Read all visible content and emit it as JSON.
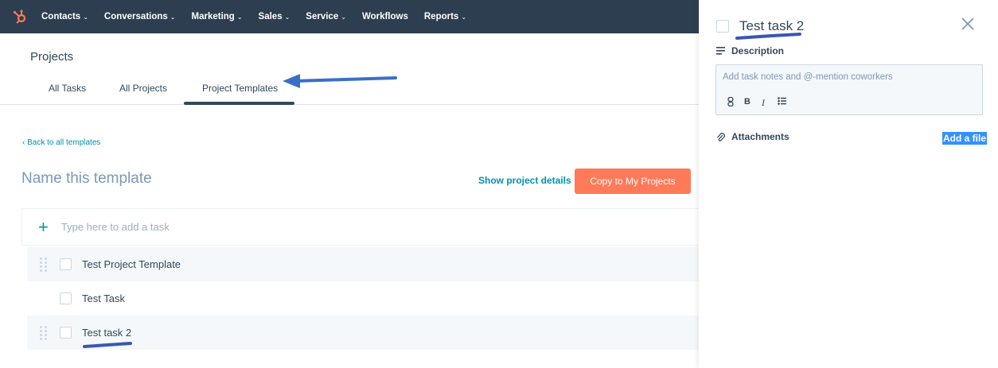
{
  "nav": {
    "items": [
      {
        "label": "Contacts",
        "caret": "⌄"
      },
      {
        "label": "Conversations",
        "caret": "⌄"
      },
      {
        "label": "Marketing",
        "caret": "⌄"
      },
      {
        "label": "Sales",
        "caret": "⌄"
      },
      {
        "label": "Service",
        "caret": "⌄"
      },
      {
        "label": "Workflows",
        "caret": ""
      },
      {
        "label": "Reports",
        "caret": "⌄"
      }
    ]
  },
  "page": {
    "title": "Projects",
    "tabs": [
      {
        "label": "All Tasks"
      },
      {
        "label": "All Projects"
      },
      {
        "label": "Project Templates",
        "active": true
      }
    ],
    "back_link": "‹  Back to all templates",
    "template_name_placeholder": "Name this template",
    "show_details_label": "Show project details",
    "copy_button_label": "Copy to My Projects",
    "add_task_placeholder": "Type here to add a task",
    "tasks": [
      {
        "label": "Test Project Template"
      },
      {
        "label": "Test Task"
      },
      {
        "label": "Test task 2"
      }
    ]
  },
  "panel": {
    "title": "Test task 2",
    "description_label": "Description",
    "description_placeholder": "Add task notes and @-mention coworkers",
    "toolbar": {
      "link": "🔗",
      "bold": "B",
      "italic": "I",
      "list": "☰"
    },
    "attachments_label": "Attachments",
    "add_file_label": "Add a file"
  },
  "colors": {
    "nav_bg": "#2d3e50",
    "accent": "#0091ae",
    "cta": "#ff7a59",
    "annotation": "#3b6fc7",
    "highlight": "#3390ff"
  }
}
